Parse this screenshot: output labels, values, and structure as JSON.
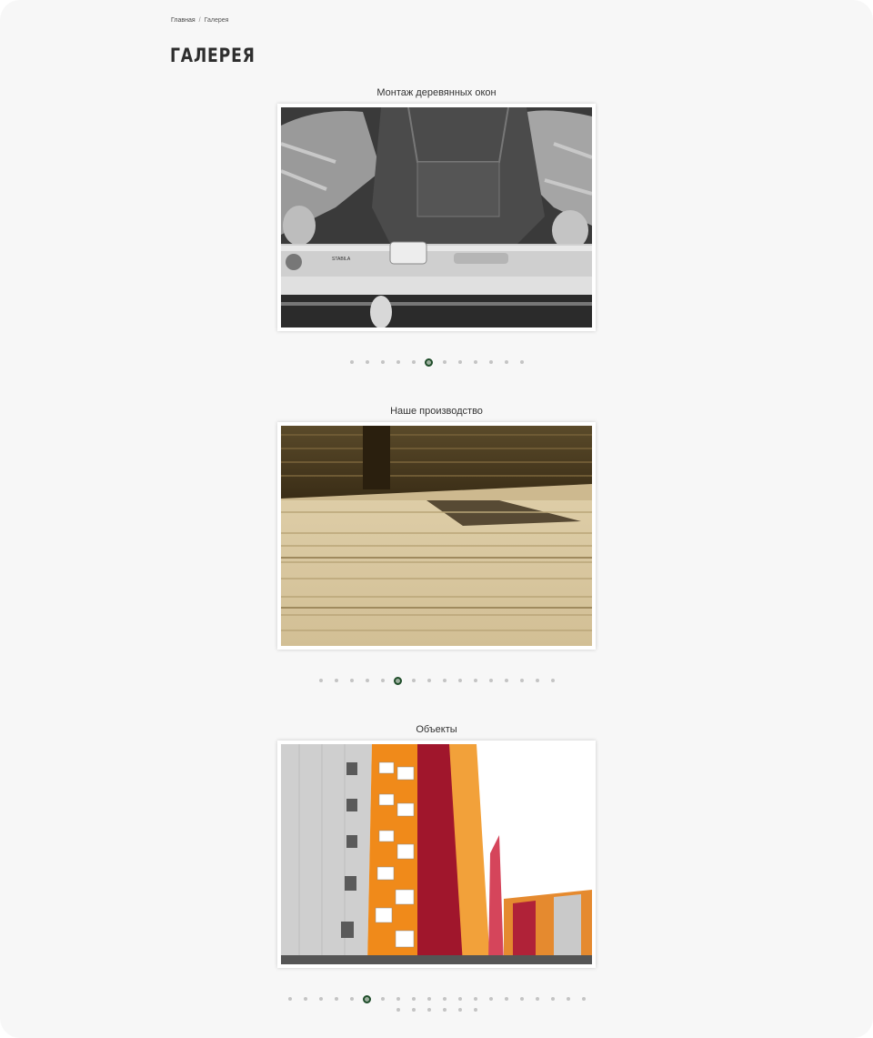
{
  "breadcrumb": {
    "home": "Главная",
    "separator": "/",
    "current": "Галерея"
  },
  "page_title": "ГАЛЕРЕЯ",
  "galleries": [
    {
      "title": "Монтаж деревянных окон",
      "dots_total": 12,
      "active_index": 5,
      "photo": "window-installation"
    },
    {
      "title": "Наше производство",
      "dots_total": 16,
      "active_index": 5,
      "photo": "wood-production"
    },
    {
      "title": "Объекты",
      "dots_total": 26,
      "active_index": 5,
      "photo": "apartment-buildings"
    }
  ],
  "colors": {
    "background": "#f7f7f7",
    "dot": "#c4c4c4",
    "dot_active_border": "#1f4d2a",
    "dot_active_fill": "#9db09f"
  }
}
